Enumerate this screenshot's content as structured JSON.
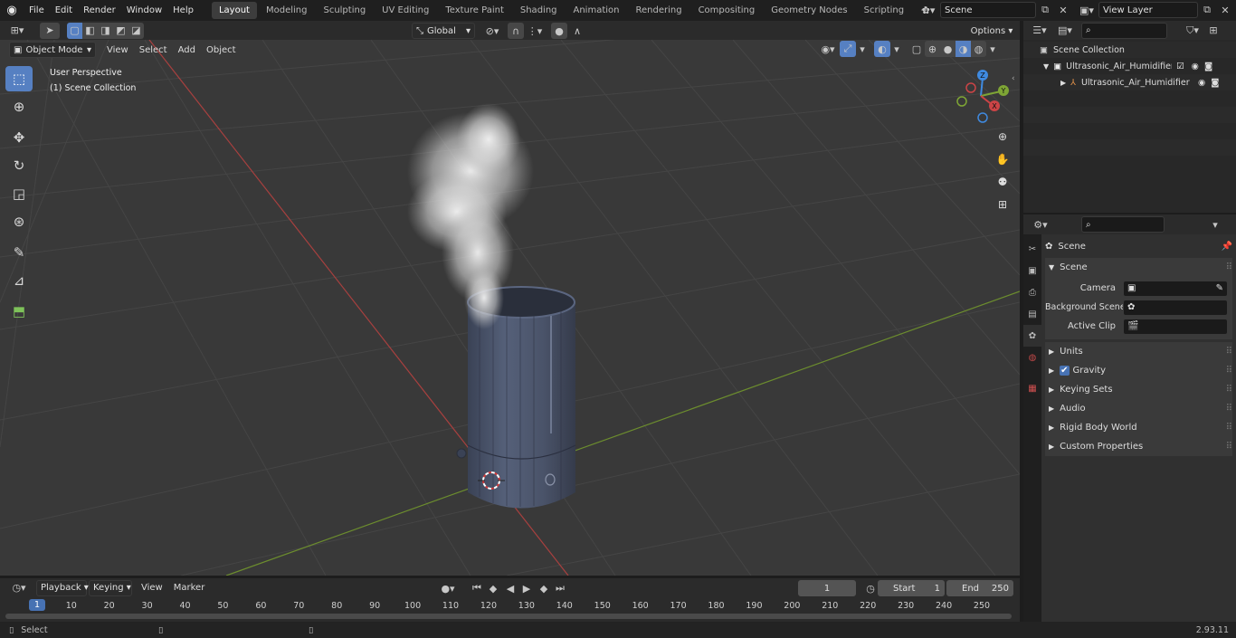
{
  "topbar": {
    "menus": [
      "File",
      "Edit",
      "Render",
      "Window",
      "Help"
    ],
    "workspace_tabs": [
      "Layout",
      "Modeling",
      "Sculpting",
      "UV Editing",
      "Texture Paint",
      "Shading",
      "Animation",
      "Rendering",
      "Compositing",
      "Geometry Nodes",
      "Scripting"
    ],
    "active_tab": "Layout",
    "scene_name": "Scene",
    "view_layer": "View Layer"
  },
  "viewport_header": {
    "mode": "Object Mode",
    "menus": [
      "View",
      "Select",
      "Add",
      "Object"
    ],
    "transform_orientation": "Global",
    "options_label": "Options"
  },
  "viewport": {
    "overlay_line1": "User Perspective",
    "overlay_line2": "(1) Scene Collection",
    "gizmo_axes": [
      "X",
      "Y",
      "Z"
    ],
    "colors": {
      "x_axis": "#cb4446",
      "y_axis": "#7ea535",
      "z_axis": "#3f8ae0",
      "bg": "#393939",
      "grid": "#444444"
    }
  },
  "toolbar": {
    "tools": [
      "select-box-icon",
      "cursor-icon",
      "move-icon",
      "rotate-icon",
      "scale-icon",
      "transform-icon",
      "annotate-icon",
      "measure-icon",
      "add-cube-icon"
    ]
  },
  "outliner": {
    "root": "Scene Collection",
    "items": [
      {
        "label": "Ultrasonic_Air_Humidifier_with"
      },
      {
        "label": "Ultrasonic_Air_Humidifier"
      }
    ]
  },
  "properties": {
    "context": "Scene",
    "panel_title": "Scene",
    "fields": [
      {
        "label": "Camera"
      },
      {
        "label": "Background Scene"
      },
      {
        "label": "Active Clip"
      }
    ],
    "sections": [
      "Units",
      "Gravity",
      "Keying Sets",
      "Audio",
      "Rigid Body World",
      "Custom Properties"
    ]
  },
  "timeline": {
    "menus": [
      "Playback",
      "Keying",
      "View",
      "Marker"
    ],
    "current_frame": "1",
    "start_label": "Start",
    "start_value": "1",
    "end_label": "End",
    "end_value": "250",
    "ticks": [
      "1",
      "10",
      "20",
      "30",
      "40",
      "50",
      "60",
      "70",
      "80",
      "90",
      "100",
      "110",
      "120",
      "130",
      "140",
      "150",
      "160",
      "170",
      "180",
      "190",
      "200",
      "210",
      "220",
      "230",
      "240",
      "250"
    ]
  },
  "statusbar": {
    "left_label": "Select",
    "version": "2.93.11"
  }
}
